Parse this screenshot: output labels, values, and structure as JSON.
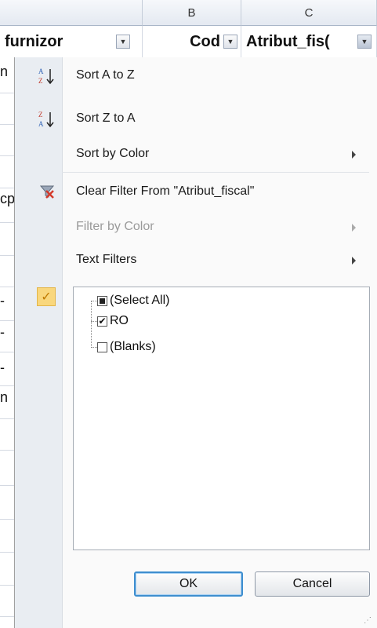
{
  "columns": [
    {
      "letter": ""
    },
    {
      "letter": "B"
    },
    {
      "letter": "C"
    }
  ],
  "header_cells": {
    "col_a": "furnizor",
    "col_b": "Cod",
    "col_c": "Atribut_fis("
  },
  "left_partial": [
    "n",
    "cp",
    "-",
    "-",
    "-",
    "n"
  ],
  "menu": {
    "sort_az": "Sort A to Z",
    "sort_za": "Sort Z to A",
    "sort_color": "Sort by Color",
    "clear_filter": "Clear Filter From \"Atribut_fiscal\"",
    "filter_color": "Filter by Color",
    "text_filters": "Text Filters"
  },
  "list": {
    "items": [
      {
        "label": "(Select All)",
        "state": "partial"
      },
      {
        "label": "RO",
        "state": "checked"
      },
      {
        "label": "(Blanks)",
        "state": "unchecked"
      }
    ]
  },
  "buttons": {
    "ok": "OK",
    "cancel": "Cancel"
  },
  "icons": {
    "sort_az": "sort-ascending-icon",
    "sort_za": "sort-descending-icon",
    "clear_filter": "clear-filter-icon",
    "check": "checkmark-icon"
  },
  "colors": {
    "accent": "#3e8ecf",
    "check_bg": "#f9d77d",
    "clear_filter_red": "#d33a2c"
  }
}
